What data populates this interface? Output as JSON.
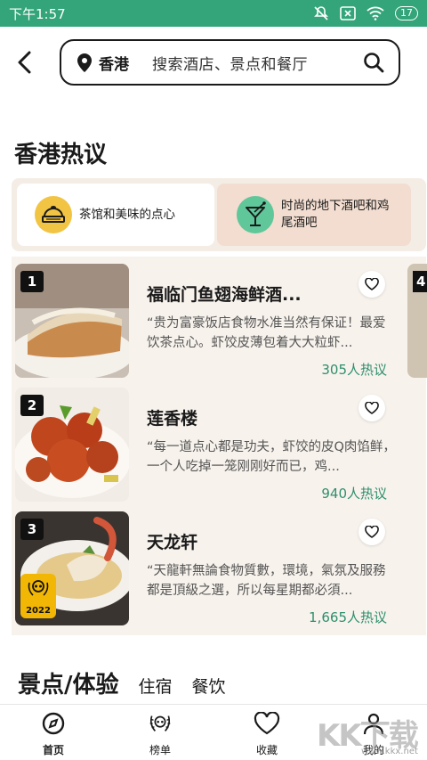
{
  "status_bar": {
    "time": "下午1:57",
    "battery": "17"
  },
  "search": {
    "location": "香港",
    "placeholder": "搜索酒店、景点和餐厅"
  },
  "hot_section": {
    "title": "香港热议",
    "categories": [
      {
        "label": "茶馆和美味的点心",
        "active": true,
        "icon": "dim-sum-steamer-icon"
      },
      {
        "label": "时尚的地下酒吧和鸡尾酒吧",
        "active": false,
        "icon": "cocktail-glass-icon"
      }
    ],
    "restaurants": [
      {
        "rank": "1",
        "name": "福临门鱼翅海鲜酒...",
        "quote": "“贵为富豪饭店食物水准当然有保证！最爱饮茶点心。虾饺皮薄包着大大粒虾...",
        "count": "305人热议"
      },
      {
        "rank": "2",
        "name": "莲香楼",
        "quote": "“每一道点心都是功夫，虾饺的皮Q肉馅鲜，一个人吃掉一笼刚刚好而已，鸡...",
        "count": "940人热议"
      },
      {
        "rank": "3",
        "name": "天龙轩",
        "quote": "“天龍軒無論食物質數，環境，氣氛及服務都是頂級之選，所以每星期都必須...",
        "count": "1,665人热议",
        "award_year": "2022"
      }
    ],
    "peek_rank": "4"
  },
  "section2": {
    "title": "景点/体验",
    "tabs": [
      "住宿",
      "餐饮"
    ]
  },
  "bottom_nav": [
    {
      "label": "首页",
      "icon": "compass-icon",
      "active": true
    },
    {
      "label": "榜单",
      "icon": "laurel-award-icon",
      "active": false
    },
    {
      "label": "收藏",
      "icon": "heart-icon",
      "active": false
    },
    {
      "label": "我的",
      "icon": "profile-icon",
      "active": false
    }
  ],
  "watermark": {
    "text": "KK下载",
    "url": "www.kkx.net"
  },
  "colors": {
    "status_bar": "#34a57a",
    "accent_green": "#2f8f6e",
    "cat_yellow": "#f2c443",
    "cat_green": "#5fc79a",
    "award_gold": "#f2b705"
  }
}
